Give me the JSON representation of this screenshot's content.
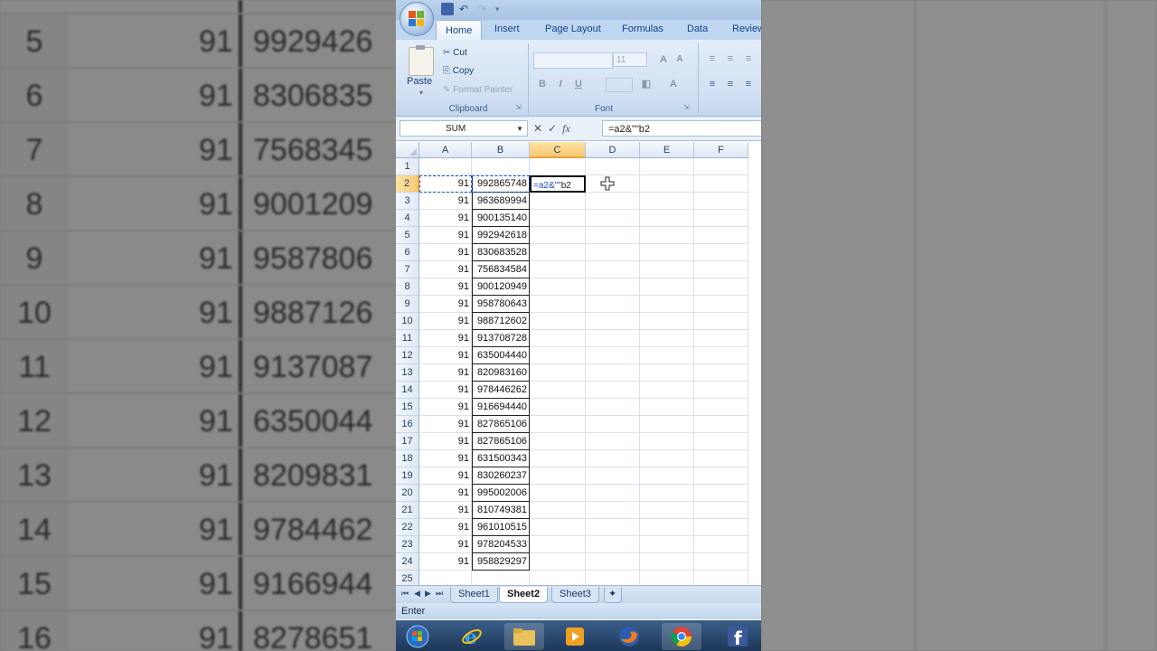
{
  "background": {
    "rows": [
      {
        "num": "5",
        "a": "91",
        "b": "9929426"
      },
      {
        "num": "6",
        "a": "91",
        "b": "8306835"
      },
      {
        "num": "7",
        "a": "91",
        "b": "7568345"
      },
      {
        "num": "8",
        "a": "91",
        "b": "9001209"
      },
      {
        "num": "9",
        "a": "91",
        "b": "9587806"
      },
      {
        "num": "10",
        "a": "91",
        "b": "9887126"
      },
      {
        "num": "11",
        "a": "91",
        "b": "9137087"
      },
      {
        "num": "12",
        "a": "91",
        "b": "6350044"
      },
      {
        "num": "13",
        "a": "91",
        "b": "8209831"
      },
      {
        "num": "14",
        "a": "91",
        "b": "9784462"
      },
      {
        "num": "15",
        "a": "91",
        "b": "9166944"
      },
      {
        "num": "16",
        "a": "91",
        "b": "8278651"
      }
    ]
  },
  "ribbon": {
    "tabs": [
      "Home",
      "Insert",
      "Page Layout",
      "Formulas",
      "Data",
      "Review"
    ],
    "clipboard": {
      "paste": "Paste",
      "cut": "Cut",
      "copy": "Copy",
      "format_painter": "Format Painter",
      "label": "Clipboard"
    },
    "font": {
      "size": "11",
      "bold": "B",
      "italic": "I",
      "underline": "U",
      "label": "Font"
    }
  },
  "formula_bar": {
    "name_box": "SUM",
    "formula": "=a2&\"\"b2"
  },
  "columns": [
    "A",
    "B",
    "C",
    "D",
    "E",
    "F"
  ],
  "active_cell": {
    "row": "2",
    "col": "C",
    "text_prefix": "=a2&\"\"",
    "text_ref": "b2"
  },
  "rows": [
    {
      "num": "1",
      "a": "",
      "b": ""
    },
    {
      "num": "2",
      "a": "91",
      "b": "992865748"
    },
    {
      "num": "3",
      "a": "91",
      "b": "963689994"
    },
    {
      "num": "4",
      "a": "91",
      "b": "900135140"
    },
    {
      "num": "5",
      "a": "91",
      "b": "992942618"
    },
    {
      "num": "6",
      "a": "91",
      "b": "830683528"
    },
    {
      "num": "7",
      "a": "91",
      "b": "756834584"
    },
    {
      "num": "8",
      "a": "91",
      "b": "900120949"
    },
    {
      "num": "9",
      "a": "91",
      "b": "958780643"
    },
    {
      "num": "10",
      "a": "91",
      "b": "988712602"
    },
    {
      "num": "11",
      "a": "91",
      "b": "913708728"
    },
    {
      "num": "12",
      "a": "91",
      "b": "635004440"
    },
    {
      "num": "13",
      "a": "91",
      "b": "820983160"
    },
    {
      "num": "14",
      "a": "91",
      "b": "978446262"
    },
    {
      "num": "15",
      "a": "91",
      "b": "916694440"
    },
    {
      "num": "16",
      "a": "91",
      "b": "827865106"
    },
    {
      "num": "17",
      "a": "91",
      "b": "827865106"
    },
    {
      "num": "18",
      "a": "91",
      "b": "631500343"
    },
    {
      "num": "19",
      "a": "91",
      "b": "830260237"
    },
    {
      "num": "20",
      "a": "91",
      "b": "995002006"
    },
    {
      "num": "21",
      "a": "91",
      "b": "810749381"
    },
    {
      "num": "22",
      "a": "91",
      "b": "961010515"
    },
    {
      "num": "23",
      "a": "91",
      "b": "978204533"
    },
    {
      "num": "24",
      "a": "91",
      "b": "958829297"
    },
    {
      "num": "25",
      "a": "",
      "b": ""
    }
  ],
  "sheets": [
    "Sheet1",
    "Sheet2",
    "Sheet3"
  ],
  "active_sheet": "Sheet2",
  "status": {
    "mode": "Enter"
  },
  "taskbar": [
    "start-orb-icon",
    "ie-icon",
    "folder-icon",
    "media-player-icon",
    "firefox-icon",
    "chrome-icon",
    "facebook-icon"
  ],
  "colors": {
    "accent": "#15428b",
    "selection": "#f8c873",
    "ribbon": "#d0dff2"
  }
}
